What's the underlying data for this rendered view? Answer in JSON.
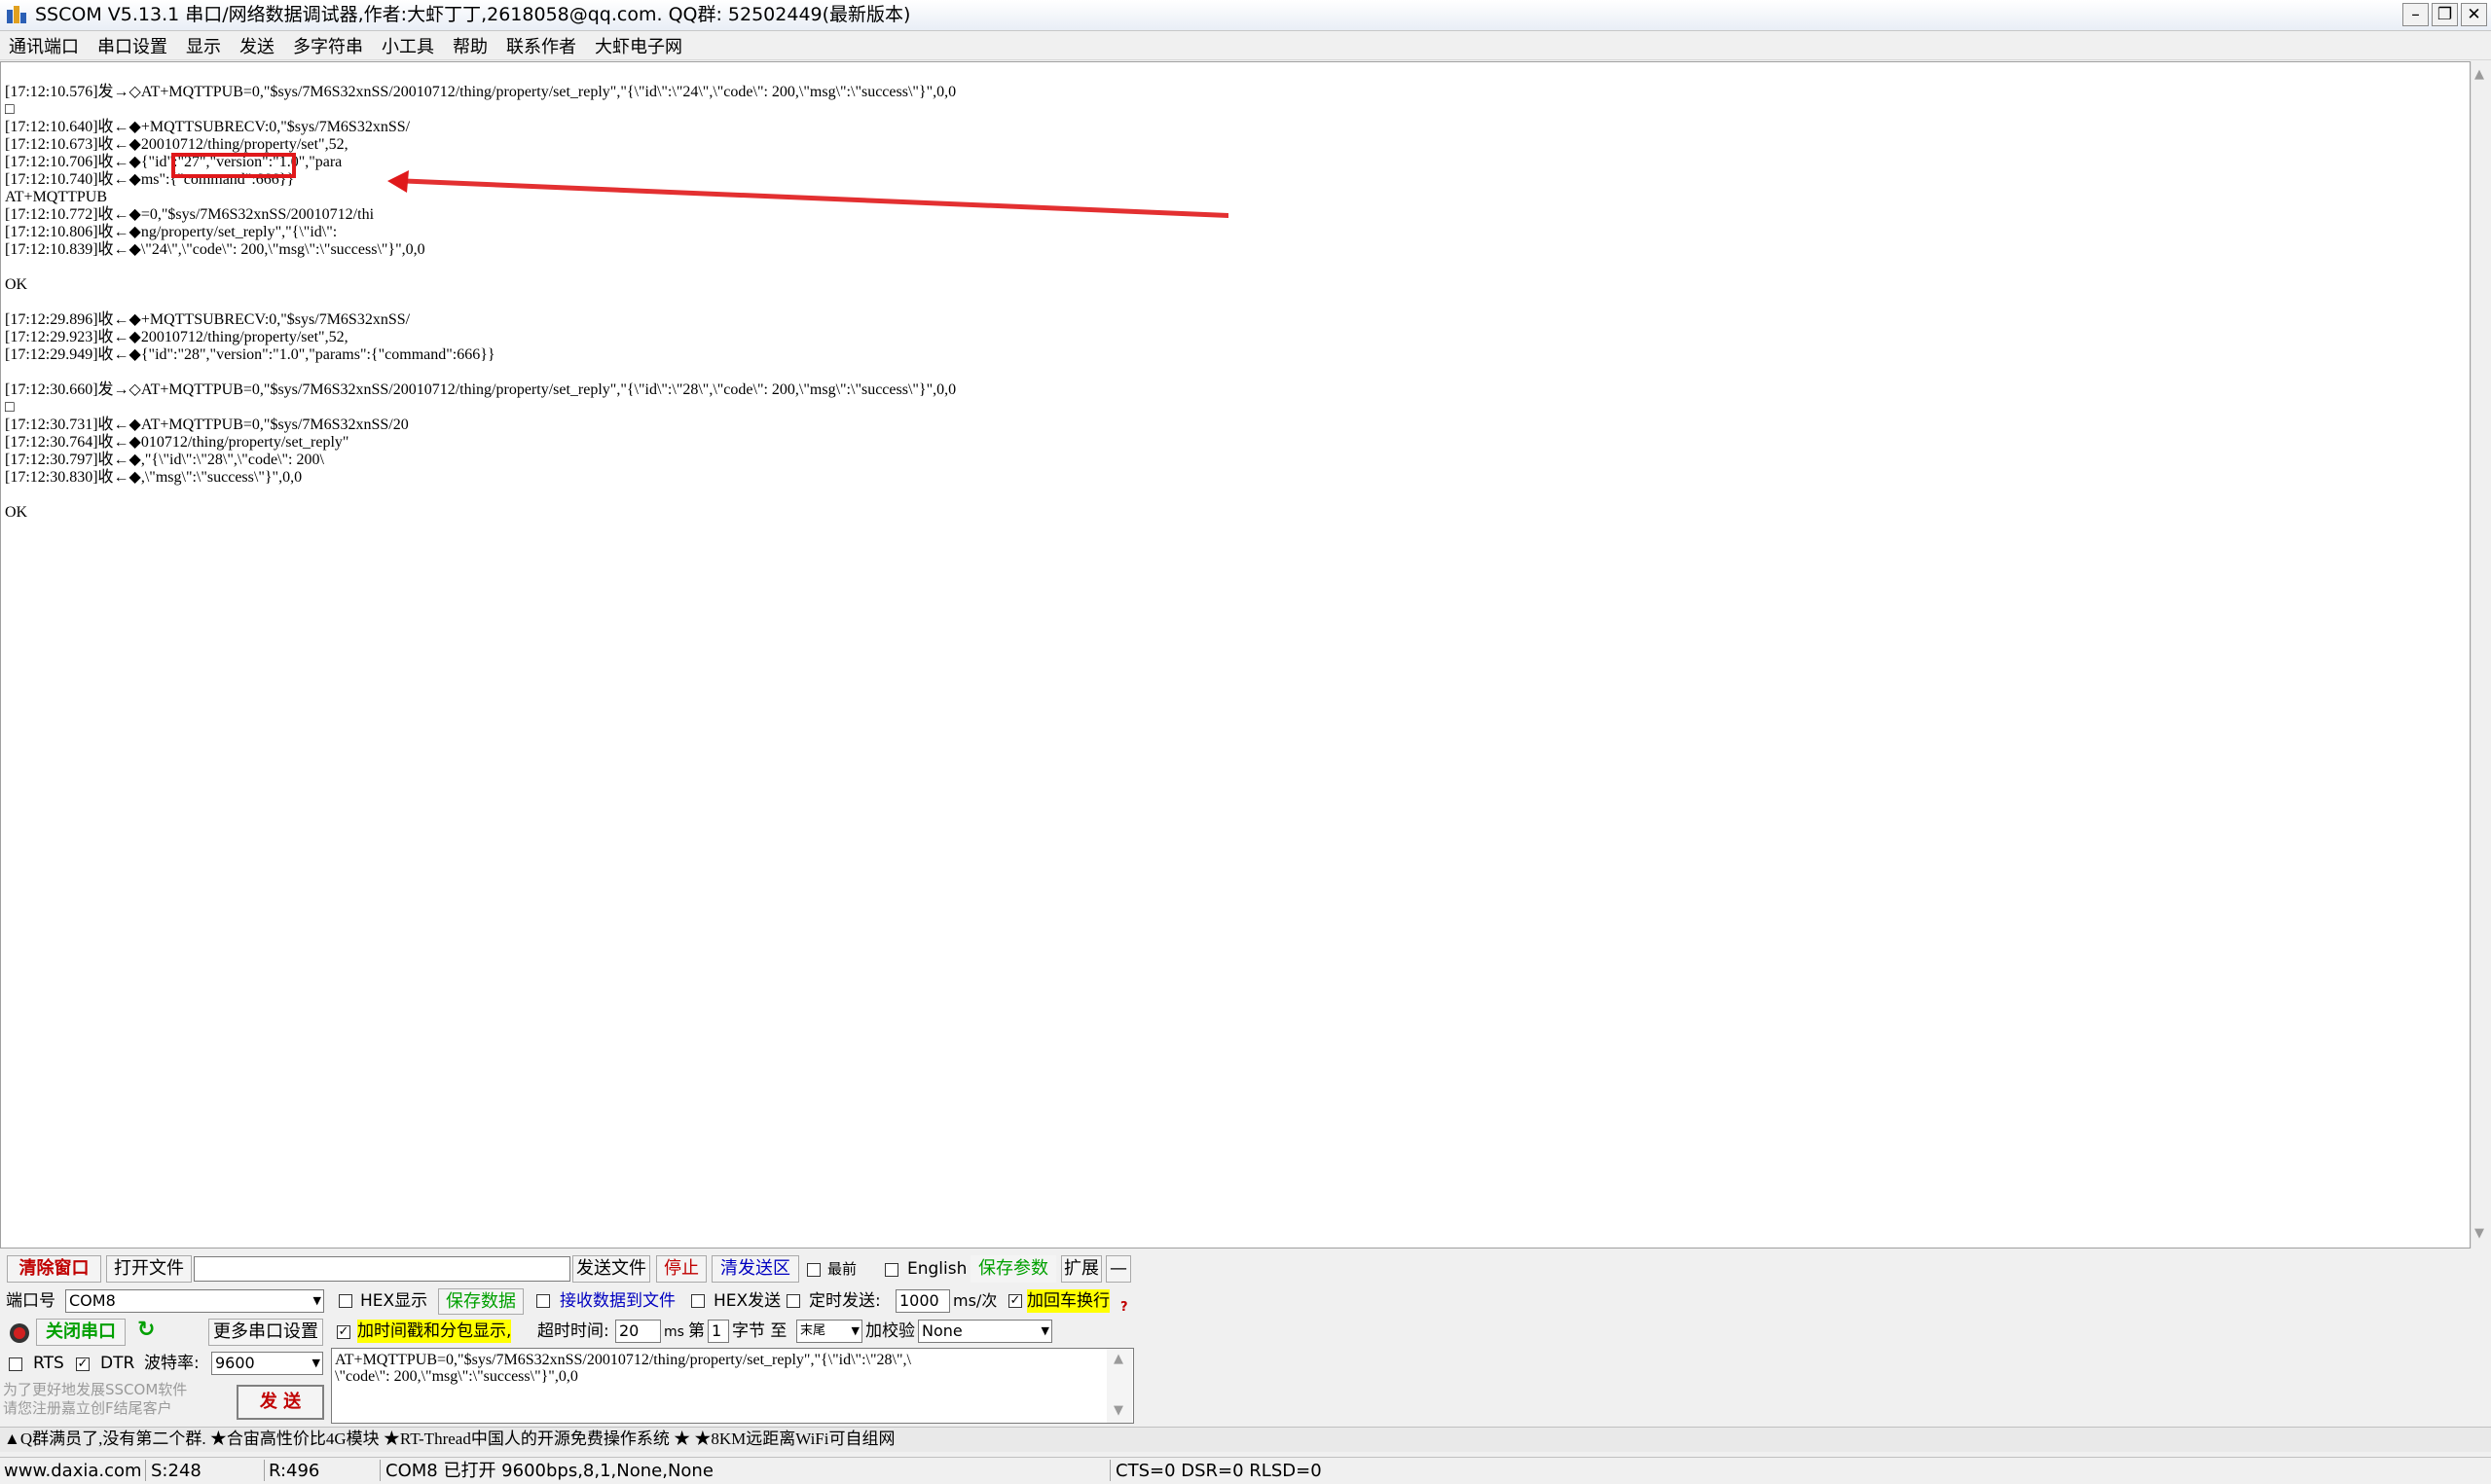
{
  "window": {
    "title": "SSCOM V5.13.1 串口/网络数据调试器,作者:大虾丁丁,2618058@qq.com. QQ群: 52502449(最新版本)",
    "minimize": "–",
    "maximize": "❐",
    "close": "✕"
  },
  "menu": [
    "通讯端口",
    "串口设置",
    "显示",
    "发送",
    "多字符串",
    "小工具",
    "帮助",
    "联系作者",
    "大虾电子网"
  ],
  "log": [
    "[17:12:10.576]发→◇AT+MQTTPUB=0,\"$sys/7M6S32xnSS/20010712/thing/property/set_reply\",\"{\\\"id\\\":\\\"24\\\",\\\"code\\\": 200,\\\"msg\\\":\\\"success\\\"}\",0,0",
    "□",
    "[17:12:10.640]收←◆+MQTTSUBRECV:0,\"$sys/7M6S32xnSS/",
    "[17:12:10.673]收←◆20010712/thing/property/set\",52,",
    "[17:12:10.706]收←◆{\"id\":\"27\",\"version\":\"1.0\",\"para",
    "[17:12:10.740]收←◆ms\":{\"command\":666}}",
    "AT+MQTTPUB",
    "[17:12:10.772]收←◆=0,\"$sys/7M6S32xnSS/20010712/thi",
    "[17:12:10.806]收←◆ng/property/set_reply\",\"{\\\"id\\\":",
    "[17:12:10.839]收←◆\\\"24\\\",\\\"code\\\": 200,\\\"msg\\\":\\\"success\\\"}\",0,0",
    "",
    "OK",
    "",
    "[17:12:29.896]收←◆+MQTTSUBRECV:0,\"$sys/7M6S32xnSS/",
    "[17:12:29.923]收←◆20010712/thing/property/set\",52,",
    "[17:12:29.949]收←◆{\"id\":\"28\",\"version\":\"1.0\",\"params\":{\"command\":666}}",
    "",
    "[17:12:30.660]发→◇AT+MQTTPUB=0,\"$sys/7M6S32xnSS/20010712/thing/property/set_reply\",\"{\\\"id\\\":\\\"28\\\",\\\"code\\\": 200,\\\"msg\\\":\\\"success\\\"}\",0,0",
    "□",
    "[17:12:30.731]收←◆AT+MQTTPUB=0,\"$sys/7M6S32xnSS/20",
    "[17:12:30.764]收←◆010712/thing/property/set_reply\"",
    "[17:12:30.797]收←◆,\"{\\\"id\\\":\\\"28\\\",\\\"code\\\": 200\\",
    "[17:12:30.830]收←◆,\\\"msg\\\":\\\"success\\\"}\",0,0",
    "",
    "OK"
  ],
  "toolbar": {
    "clear_window": "清除窗口",
    "open_file": "打开文件",
    "file_path": "",
    "send_file": "发送文件",
    "stop": "停止",
    "clear_send": "清发送区",
    "topmost": "最前",
    "english": "English",
    "save_params": "保存参数",
    "expand": "扩展",
    "collapse": "—"
  },
  "port": {
    "port_label": "端口号",
    "port_value": "COM8",
    "hex_display": "HEX显示",
    "save_data": "保存数据",
    "recv_to_file": "接收数据到文件",
    "hex_send": "HEX发送",
    "timed_send": "定时发送:",
    "interval": "1000",
    "interval_unit": "ms/次",
    "add_crlf": "加回车换行",
    "close_port": "关闭串口",
    "more_settings": "更多串口设置",
    "timestamp": "加时间戳和分包显示,",
    "timeout_label": "超时时间:",
    "timeout_value": "20",
    "timeout_unit": "ms",
    "nth_label": "第",
    "nth_value": "1",
    "byte_label": "字节 至",
    "to_value": "末尾",
    "checksum_label": "加校验",
    "checksum_value": "None",
    "rts": "RTS",
    "dtr": "DTR",
    "baud_label": "波特率:",
    "baud_value": "9600",
    "promo_line1": "为了更好地发展SSCOM软件",
    "promo_line2": "请您注册嘉立创F结尾客户",
    "send": "发 送"
  },
  "send_text": [
    "AT+MQTTPUB=0,\"$sys/7M6S32xnSS/20010712/thing/property/set_reply\",\"{\\\"id\\\":\\\"28\\\",\\",
    "\\\"code\\\": 200,\\\"msg\\\":\\\"success\\\"}\",0,0"
  ],
  "ticker": "▲Q群满员了,没有第二个群. ★合宙高性价比4G模块 ★RT-Thread中国人的开源免费操作系统 ★ ★8KM远距离WiFi可自组网",
  "status": {
    "site": "www.daxia.com",
    "sent": "S:248",
    "received": "R:496",
    "port_state": "COM8 已打开  9600bps,8,1,None,None",
    "lines": "CTS=0 DSR=0 RLSD=0"
  },
  "colors": {
    "highlight": "#e0191b",
    "accent_red": "#c00000",
    "accent_green": "#00a000",
    "accent_blue": "#0000c0",
    "yellow_hl": "#ffff00"
  }
}
